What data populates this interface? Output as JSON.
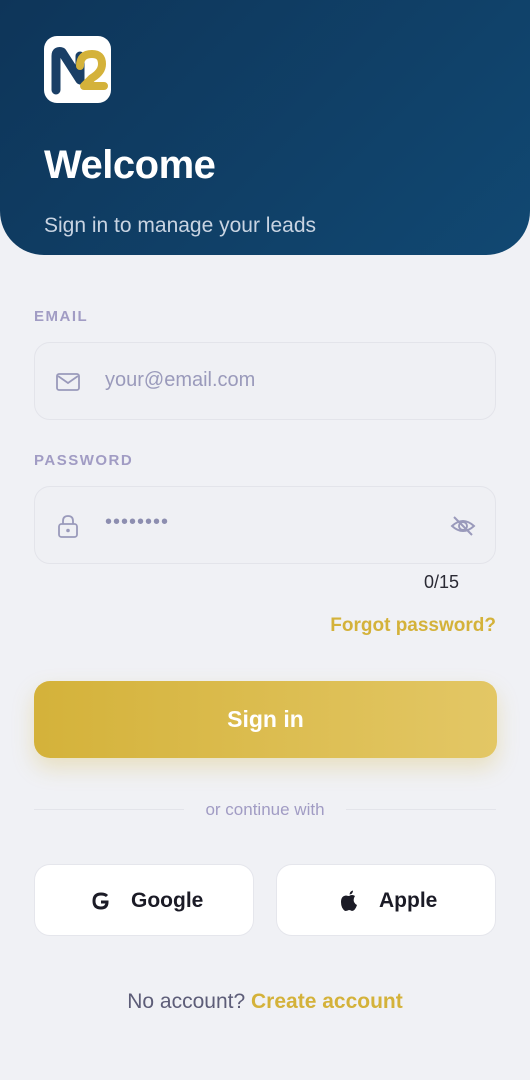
{
  "header": {
    "title": "Welcome",
    "subtitle": "Sign in to manage your leads"
  },
  "email": {
    "label": "EMAIL",
    "placeholder": "your@email.com"
  },
  "password": {
    "label": "PASSWORD",
    "value": "••••••••",
    "counter": "0/15"
  },
  "forgot_label": "Forgot password?",
  "signin_label": "Sign in",
  "divider_text": "or continue with",
  "social": {
    "google_label": "Google",
    "apple_label": "Apple"
  },
  "footer": {
    "question": "No account?",
    "link": "Create account"
  },
  "colors": {
    "header_bg": "#0e3559",
    "accent_gold": "#d4b23a",
    "page_bg": "#f0f1f5",
    "label_purple": "#a19cc4"
  },
  "icons": {
    "email": "mail-icon",
    "password": "lock-icon",
    "toggle": "eye-off-icon",
    "google": "google-icon",
    "apple": "apple-icon"
  }
}
